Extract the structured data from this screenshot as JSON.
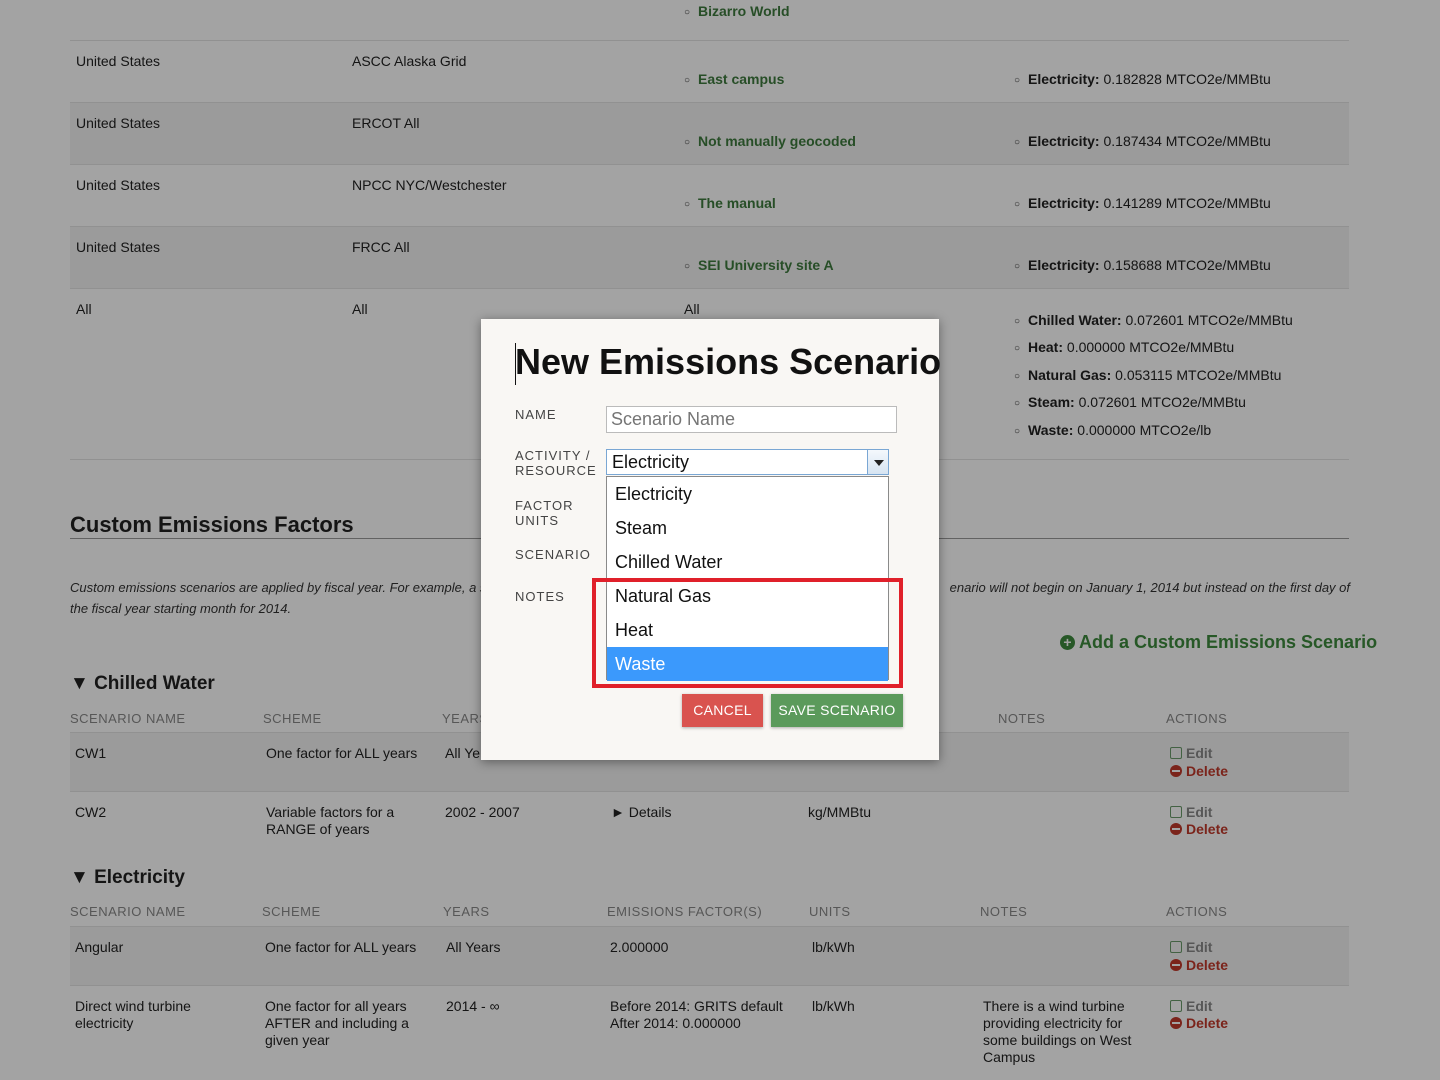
{
  "top_table": {
    "first_site": "Bizarro World",
    "rows": [
      {
        "country": "United States",
        "region": "ASCC Alaska Grid",
        "site": "East campus",
        "factor_label": "Electricity:",
        "factor_value": "0.182828 MTCO2e/MMBtu"
      },
      {
        "country": "United States",
        "region": "ERCOT All",
        "site": "Not manually geocoded",
        "factor_label": "Electricity:",
        "factor_value": "0.187434 MTCO2e/MMBtu"
      },
      {
        "country": "United States",
        "region": "NPCC NYC/Westchester",
        "site": "The manual",
        "factor_label": "Electricity:",
        "factor_value": "0.141289 MTCO2e/MMBtu"
      },
      {
        "country": "United States",
        "region": "FRCC All",
        "site": "SEI University site A",
        "factor_label": "Electricity:",
        "factor_value": "0.158688 MTCO2e/MMBtu"
      }
    ],
    "all_row": {
      "country": "All",
      "region": "All",
      "site": "All",
      "factors": [
        {
          "label": "Chilled Water:",
          "value": "0.072601 MTCO2e/MMBtu"
        },
        {
          "label": "Heat:",
          "value": "0.000000 MTCO2e/MMBtu"
        },
        {
          "label": "Natural Gas:",
          "value": "0.053115 MTCO2e/MMBtu"
        },
        {
          "label": "Steam:",
          "value": "0.072601 MTCO2e/MMBtu"
        },
        {
          "label": "Waste:",
          "value": "0.000000 MTCO2e/lb"
        }
      ]
    }
  },
  "custom": {
    "title": "Custom Emissions Factors",
    "note_left_1": "Custom emissions scenarios are applied by fiscal year. For example, a sc",
    "note_right_1": "enario will not begin on January 1, 2014 but instead on the first day of",
    "note_line_2": "the fiscal year starting month for 2014.",
    "add_link": "Add a Custom Emissions Scenario"
  },
  "chilled_water": {
    "title": "▼ Chilled Water",
    "headers": {
      "name": "SCENARIO NAME",
      "scheme": "SCHEME",
      "years": "YEARS",
      "notes": "NOTES",
      "actions": "ACTIONS"
    },
    "rows": [
      {
        "name": "CW1",
        "scheme": "One factor for ALL years",
        "years": "All Ye",
        "factors": "",
        "units": ""
      },
      {
        "name": "CW2",
        "scheme": "Variable factors for a RANGE of years",
        "years": "2002 - 2007",
        "factors": "► Details",
        "units": "kg/MMBtu"
      }
    ]
  },
  "electricity": {
    "title": "▼ Electricity",
    "headers": {
      "name": "SCENARIO NAME",
      "scheme": "SCHEME",
      "years": "YEARS",
      "factors": "EMISSIONS FACTOR(S)",
      "units": "UNITS",
      "notes": "NOTES",
      "actions": "ACTIONS"
    },
    "rows": [
      {
        "name": "Angular",
        "scheme": "One factor for ALL years",
        "years": "All Years",
        "factors": "2.000000",
        "units": "lb/kWh",
        "notes": ""
      },
      {
        "name": "Direct wind turbine electricity",
        "scheme": "One factor for all years AFTER and including a given year",
        "years": "2014 - ∞",
        "factors_1": "Before 2014: GRITS default",
        "factors_2": "After 2014: 0.000000",
        "units": "lb/kWh",
        "notes": "There is a wind turbine providing electricity for some buildings on West Campus"
      }
    ]
  },
  "actions": {
    "edit": "Edit",
    "delete": "Delete"
  },
  "modal": {
    "title": "New Emissions Scenario",
    "name_label": "NAME",
    "name_placeholder": "Scenario Name",
    "activity_label_1": "ACTIVITY /",
    "activity_label_2": "RESOURCE",
    "factor_label_1": "FACTOR",
    "factor_label_2": "UNITS",
    "scenario_label": "SCENARIO",
    "notes_label": "NOTES",
    "selected_value": "Electricity",
    "options": [
      "Electricity",
      "Steam",
      "Chilled Water",
      "Natural Gas",
      "Heat",
      "Waste"
    ],
    "cancel": "CANCEL",
    "save": "SAVE SCENARIO"
  },
  "colors": {
    "accent_green": "#3d8a3d",
    "danger": "#d9534f",
    "highlight": "#e0202a",
    "select_blue": "#3b99fc"
  }
}
